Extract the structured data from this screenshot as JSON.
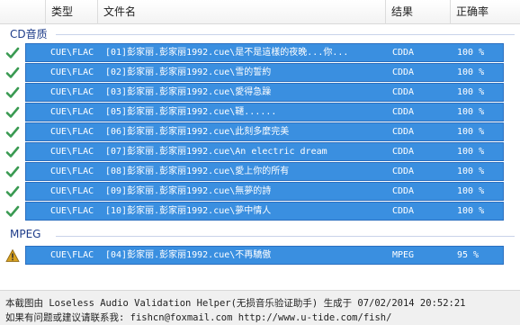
{
  "columns": {
    "type": "类型",
    "filename": "文件名",
    "result": "结果",
    "accuracy": "正确率"
  },
  "groups": [
    {
      "name": "CD音质",
      "rows": [
        {
          "status": "ok",
          "type": "CUE\\FLAC",
          "filename": "[01]彭家丽.彭家丽1992.cue\\是不是這樣的夜晚...你...",
          "result": "CDDA",
          "accuracy": "100 %"
        },
        {
          "status": "ok",
          "type": "CUE\\FLAC",
          "filename": "[02]彭家丽.彭家丽1992.cue\\雪的誓約",
          "result": "CDDA",
          "accuracy": "100 %"
        },
        {
          "status": "ok",
          "type": "CUE\\FLAC",
          "filename": "[03]彭家丽.彭家丽1992.cue\\愛得急躁",
          "result": "CDDA",
          "accuracy": "100 %"
        },
        {
          "status": "ok",
          "type": "CUE\\FLAC",
          "filename": "[05]彭家丽.彭家丽1992.cue\\韆......",
          "result": "CDDA",
          "accuracy": "100 %"
        },
        {
          "status": "ok",
          "type": "CUE\\FLAC",
          "filename": "[06]彭家丽.彭家丽1992.cue\\此刻多麼完美",
          "result": "CDDA",
          "accuracy": "100 %"
        },
        {
          "status": "ok",
          "type": "CUE\\FLAC",
          "filename": "[07]彭家丽.彭家丽1992.cue\\An electric dream",
          "result": "CDDA",
          "accuracy": "100 %"
        },
        {
          "status": "ok",
          "type": "CUE\\FLAC",
          "filename": "[08]彭家丽.彭家丽1992.cue\\愛上你的所有",
          "result": "CDDA",
          "accuracy": "100 %"
        },
        {
          "status": "ok",
          "type": "CUE\\FLAC",
          "filename": "[09]彭家丽.彭家丽1992.cue\\無夢的詩",
          "result": "CDDA",
          "accuracy": "100 %"
        },
        {
          "status": "ok",
          "type": "CUE\\FLAC",
          "filename": "[10]彭家丽.彭家丽1992.cue\\夢中情人",
          "result": "CDDA",
          "accuracy": "100 %"
        }
      ]
    },
    {
      "name": "MPEG",
      "rows": [
        {
          "status": "warn",
          "type": "CUE\\FLAC",
          "filename": "[04]彭家丽.彭家丽1992.cue\\不再驕傲",
          "result": "MPEG",
          "accuracy": "95 %"
        }
      ]
    }
  ],
  "footer": {
    "line1": "本截图由 Loseless Audio Validation Helper(无损音乐验证助手) 生成于 07/02/2014 20:52:21",
    "line2": "如果有问题或建议请联系我: fishcn@foxmail.com http://www.u-tide.com/fish/"
  },
  "colors": {
    "selection": "#3a8fe0",
    "check": "#3a9a52",
    "warning": "#d6a020",
    "group_text": "#1f3d8a"
  }
}
